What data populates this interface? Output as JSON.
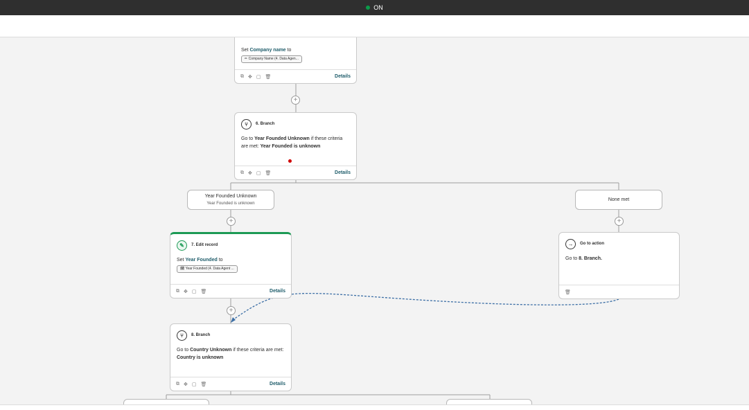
{
  "status": {
    "label": "ON",
    "color": "#0b9b4a"
  },
  "step5": {
    "set_prefix": "Set ",
    "field": "Company name",
    "set_suffix": " to",
    "token": "✏ Company Name (4. Data Agen...",
    "details": "Details"
  },
  "step6": {
    "title": "6. Branch",
    "goto_prefix": "Go to ",
    "branch_name": "Year Founded Unknown",
    "criteria_mid": " if these criteria are met: ",
    "criteria": "Year Founded is unknown",
    "details": "Details"
  },
  "branch_a": {
    "title": "Year Founded Unknown",
    "subtitle": "Year Founded is unknown"
  },
  "branch_b": {
    "title": "None met"
  },
  "step7": {
    "title": "7. Edit record",
    "set_prefix": "Set ",
    "field": "Year Founded",
    "set_suffix": " to",
    "token": "🗓 Year Founded (4. Data Agent ...",
    "details": "Details"
  },
  "goto_action": {
    "title": "Go to action",
    "text_prefix": "Go to ",
    "target": "8. Branch."
  },
  "step8": {
    "title": "8. Branch",
    "goto_prefix": "Go to ",
    "branch_name": "Country Unknown",
    "criteria_mid": " if these criteria are met: ",
    "criteria": "Country is unknown",
    "details": "Details"
  },
  "icons": {
    "toolbar": [
      "copy-icon",
      "move-icon",
      "clone-icon",
      "delete-icon"
    ],
    "branch": "branch-icon",
    "edit": "edit-record-icon",
    "goto": "arrow-right-icon",
    "add": "plus-icon"
  },
  "colors": {
    "accent": "#1f5d6b",
    "success": "#1c9a55",
    "error": "#d00000",
    "link_line": "#3b6ea5"
  }
}
